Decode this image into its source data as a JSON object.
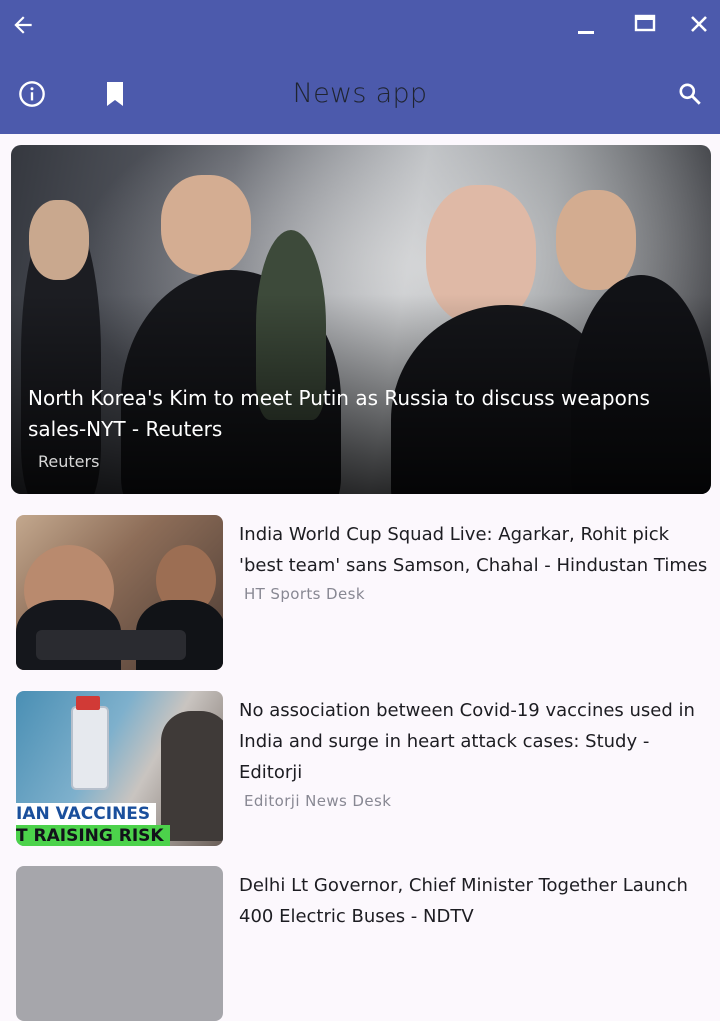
{
  "app": {
    "title": "News app",
    "colors": {
      "appbar": "#4c5aac",
      "background": "#fcf8fd"
    },
    "icons": [
      "back-arrow-icon",
      "minimize-icon",
      "maximize-icon",
      "close-icon",
      "info-icon",
      "bookmark-icon",
      "search-icon"
    ]
  },
  "hero": {
    "title": "North Korea's Kim to meet Putin as Russia to discuss weapons sales-NYT - Reuters",
    "source": "Reuters"
  },
  "articles": [
    {
      "title": "India World Cup Squad Live: Agarkar, Rohit pick 'best team' sans Samson, Chahal - Hindustan Times",
      "source": "HT Sports Desk"
    },
    {
      "title": "No association between Covid-19 vaccines used in India and surge in heart attack cases: Study - Editorji",
      "source": "Editorji News Desk",
      "image_text": {
        "line1": "IAN VACCINES",
        "line2": "T RAISING RISK"
      }
    },
    {
      "title": "Delhi Lt Governor, Chief Minister Together Launch 400 Electric Buses - NDTV",
      "source": ""
    }
  ]
}
